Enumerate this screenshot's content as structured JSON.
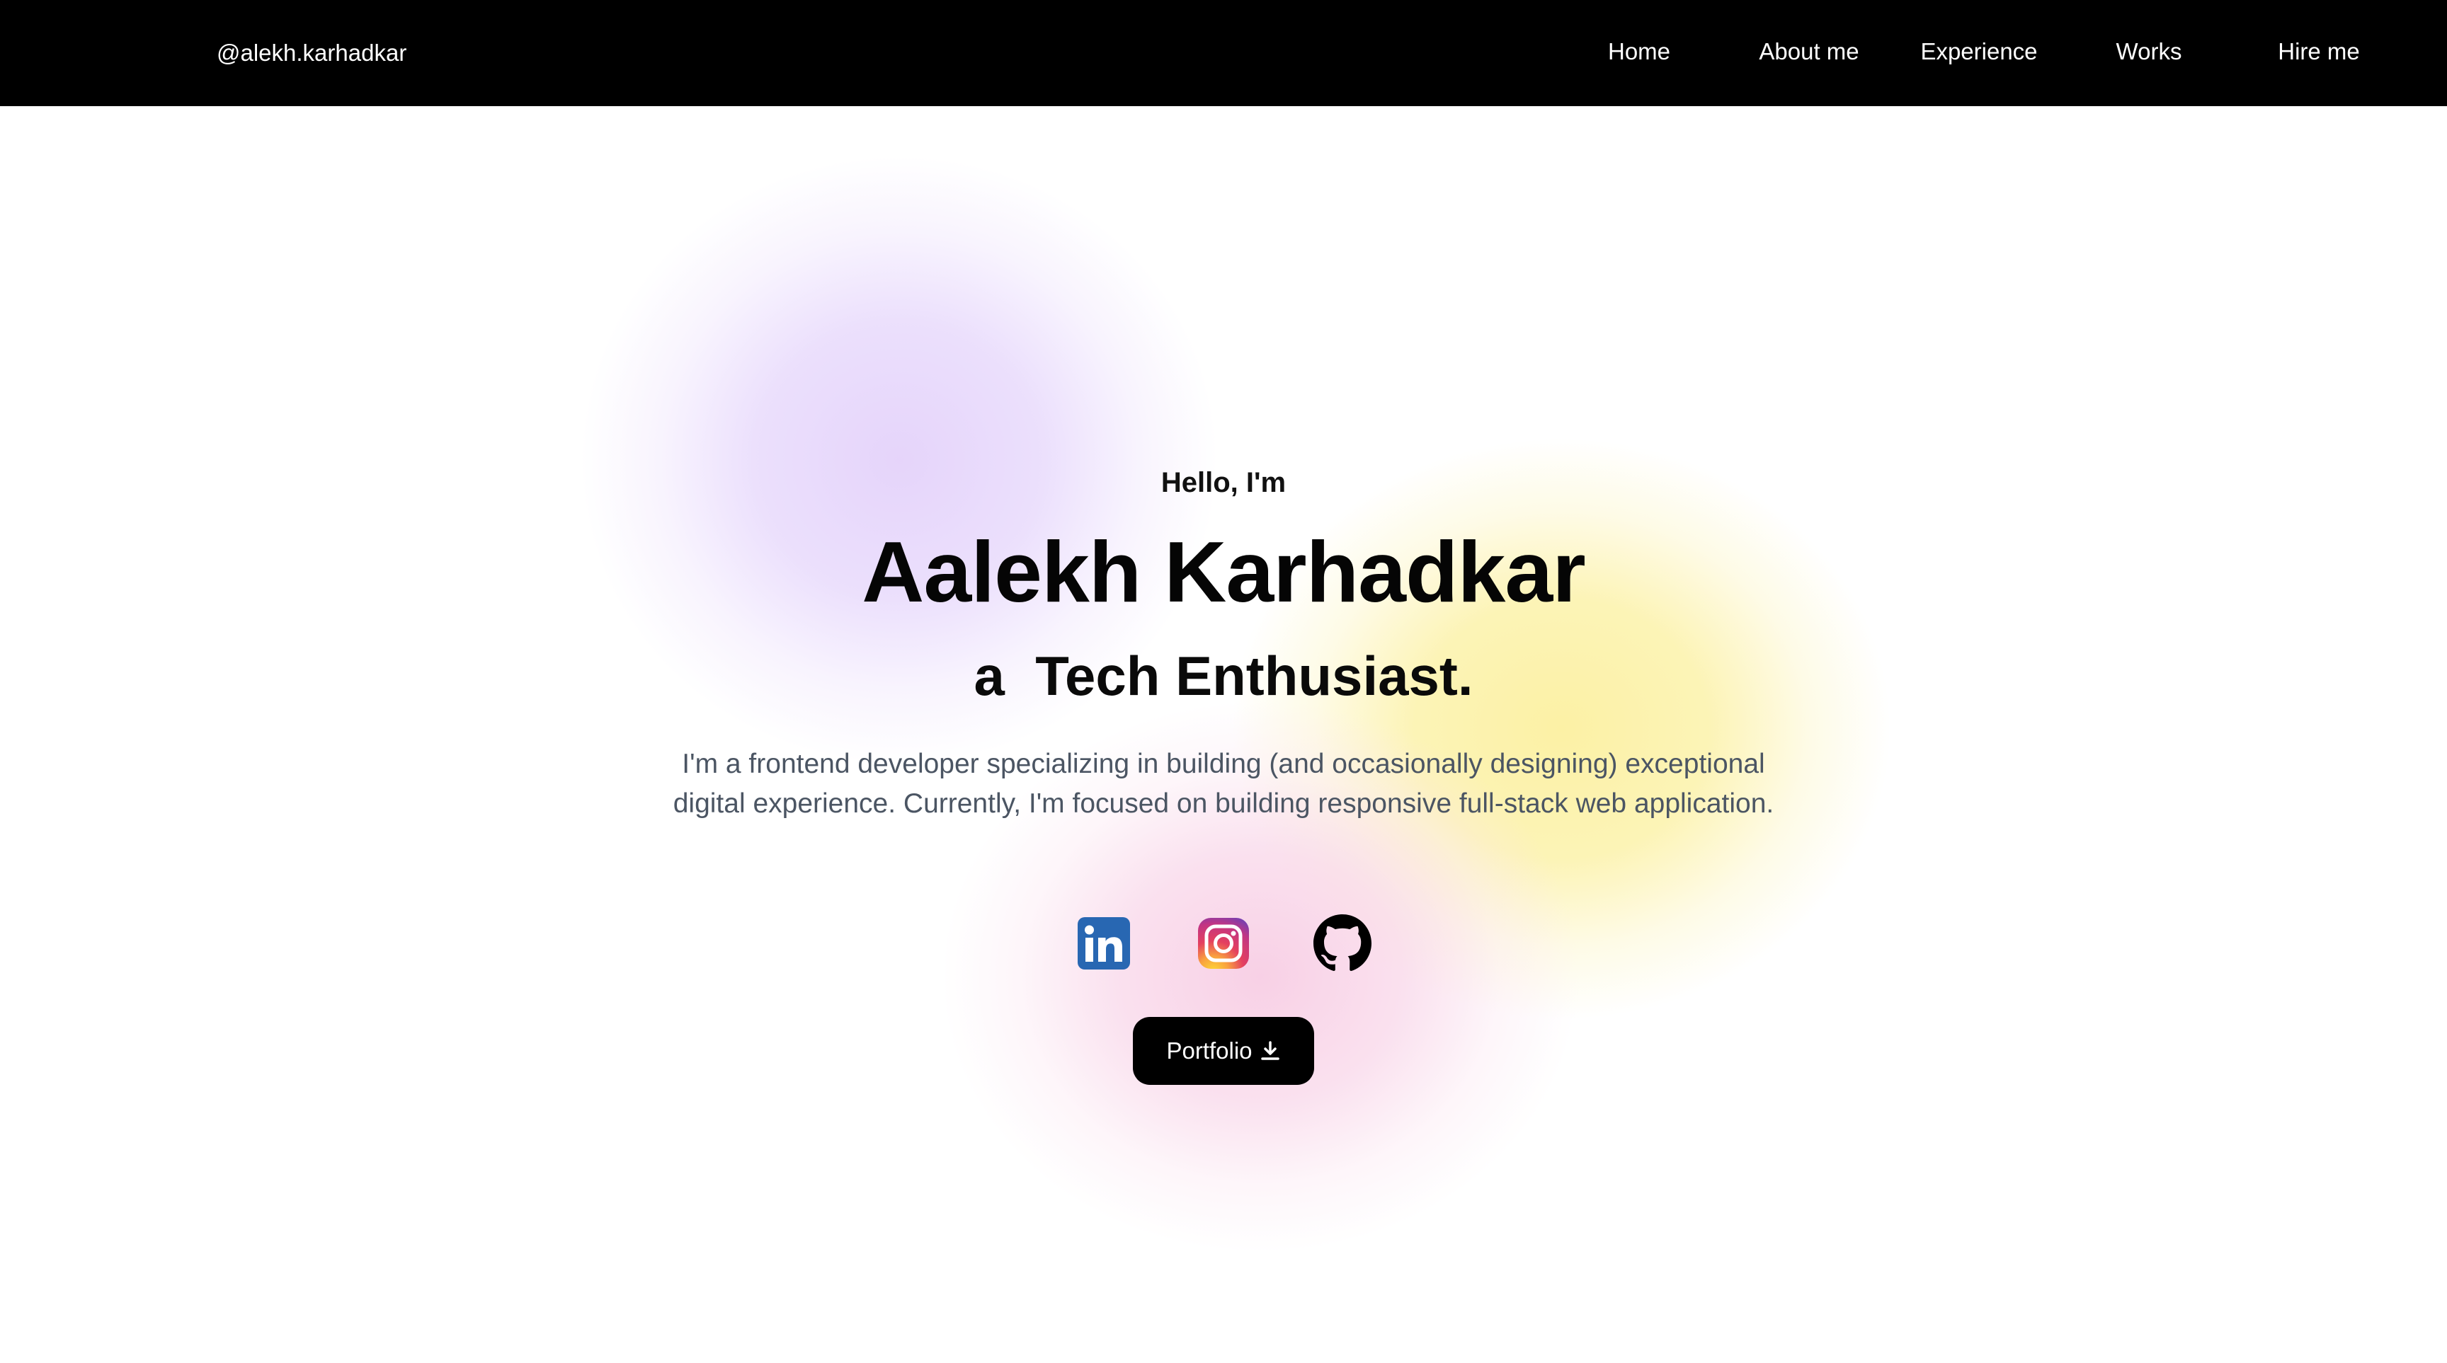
{
  "navbar": {
    "brand": "@alekh.karhadkar",
    "items": [
      {
        "label": "Home"
      },
      {
        "label": "About me"
      },
      {
        "label": "Experience"
      },
      {
        "label": "Works"
      },
      {
        "label": "Hire me"
      }
    ]
  },
  "hero": {
    "greeting": "Hello, I'm",
    "name": "Aalekh Karhadkar",
    "role": "a  Tech Enthusiast.",
    "description": "I'm a frontend developer specializing in building (and occasionally designing) exceptional digital experience. Currently, I'm focused on building responsive full-stack web application."
  },
  "socials": [
    {
      "icon": "linkedin-icon"
    },
    {
      "icon": "instagram-icon"
    },
    {
      "icon": "github-icon"
    }
  ],
  "portfolio_button": {
    "label": "Portfolio",
    "icon": "download-icon"
  },
  "colors": {
    "navbar_bg": "#000000",
    "text_primary": "#050505",
    "text_secondary": "#4b5563",
    "linkedin_blue": "#2867B2",
    "blob_purple": "#E6D6FA",
    "blob_yellow": "#FCF0A0",
    "blob_pink": "#F7C8E1"
  }
}
